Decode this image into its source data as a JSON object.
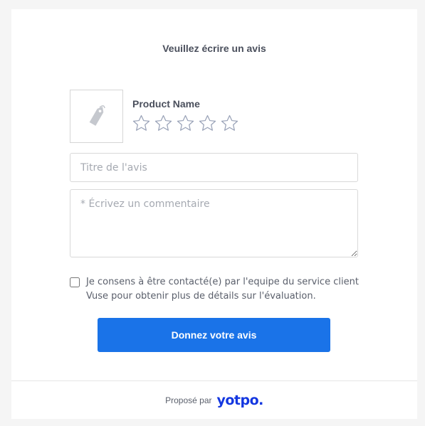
{
  "header": {
    "title": "Veuillez écrire un avis"
  },
  "product": {
    "name": "Product Name",
    "image_icon": "tag-icon"
  },
  "rating": {
    "max_stars": 5,
    "selected": 0,
    "star_icon": "star-outline-icon",
    "star_color": "#9aa3b8"
  },
  "form": {
    "title_placeholder": "Titre de l'avis",
    "comment_placeholder": "* Écrivez un commentaire",
    "consent_line1": "Je consens à être contacté(e) par l'equipe du service client",
    "consent_line2": "Vuse pour obtenir plus de détails sur l'évaluation.",
    "submit_label": "Donnez votre avis"
  },
  "footer": {
    "powered_by": "Proposé par",
    "brand": "yotpo."
  },
  "colors": {
    "accent": "#1a73e8",
    "brand": "#1437e0",
    "text": "#4a4f5c"
  }
}
